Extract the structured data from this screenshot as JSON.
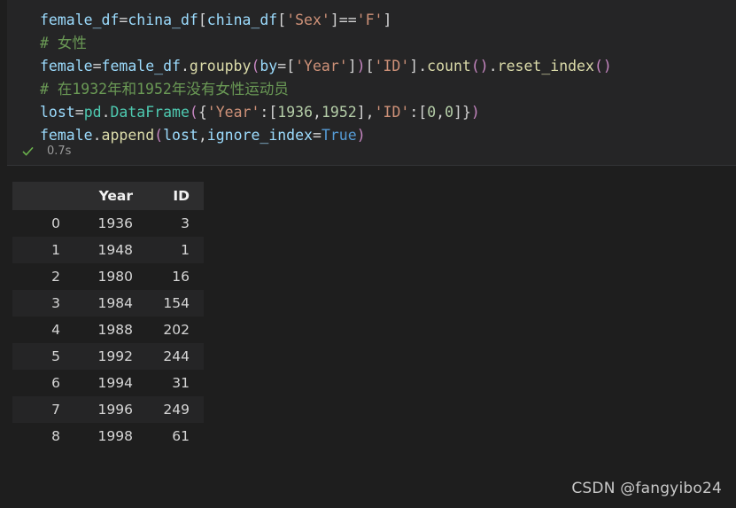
{
  "cell": {
    "code_lines": [
      [
        {
          "t": "female_df",
          "c": "t-var"
        },
        {
          "t": "=",
          "c": "t-pun"
        },
        {
          "t": "china_df",
          "c": "t-var"
        },
        {
          "t": "[",
          "c": "t-brk"
        },
        {
          "t": "china_df",
          "c": "t-var"
        },
        {
          "t": "[",
          "c": "t-brk"
        },
        {
          "t": "'Sex'",
          "c": "t-str"
        },
        {
          "t": "]",
          "c": "t-brk"
        },
        {
          "t": "==",
          "c": "t-pun"
        },
        {
          "t": "'F'",
          "c": "t-str"
        },
        {
          "t": "]",
          "c": "t-brk"
        }
      ],
      [
        {
          "t": "# 女性",
          "c": "t-com"
        }
      ],
      [
        {
          "t": "female",
          "c": "t-var"
        },
        {
          "t": "=",
          "c": "t-pun"
        },
        {
          "t": "female_df",
          "c": "t-var"
        },
        {
          "t": ".",
          "c": "t-pun"
        },
        {
          "t": "groupby",
          "c": "t-fn"
        },
        {
          "t": "(",
          "c": "t-par"
        },
        {
          "t": "by",
          "c": "t-var"
        },
        {
          "t": "=",
          "c": "t-pun"
        },
        {
          "t": "[",
          "c": "t-brk"
        },
        {
          "t": "'Year'",
          "c": "t-str"
        },
        {
          "t": "]",
          "c": "t-brk"
        },
        {
          "t": ")",
          "c": "t-par"
        },
        {
          "t": "[",
          "c": "t-brk"
        },
        {
          "t": "'ID'",
          "c": "t-str"
        },
        {
          "t": "]",
          "c": "t-brk"
        },
        {
          "t": ".",
          "c": "t-pun"
        },
        {
          "t": "count",
          "c": "t-fn"
        },
        {
          "t": "()",
          "c": "t-par"
        },
        {
          "t": ".",
          "c": "t-pun"
        },
        {
          "t": "reset_index",
          "c": "t-fn"
        },
        {
          "t": "()",
          "c": "t-par"
        }
      ],
      [
        {
          "t": "# 在1932年和1952年没有女性运动员",
          "c": "t-com"
        }
      ],
      [
        {
          "t": "lost",
          "c": "t-var"
        },
        {
          "t": "=",
          "c": "t-pun"
        },
        {
          "t": "pd",
          "c": "t-cls"
        },
        {
          "t": ".",
          "c": "t-pun"
        },
        {
          "t": "DataFrame",
          "c": "t-cls"
        },
        {
          "t": "(",
          "c": "t-par"
        },
        {
          "t": "{",
          "c": "t-brk"
        },
        {
          "t": "'Year'",
          "c": "t-str"
        },
        {
          "t": ":",
          "c": "t-pun"
        },
        {
          "t": "[",
          "c": "t-brk"
        },
        {
          "t": "1936",
          "c": "t-num"
        },
        {
          "t": ",",
          "c": "t-pun"
        },
        {
          "t": "1952",
          "c": "t-num"
        },
        {
          "t": "]",
          "c": "t-brk"
        },
        {
          "t": ",",
          "c": "t-pun"
        },
        {
          "t": "'ID'",
          "c": "t-str"
        },
        {
          "t": ":",
          "c": "t-pun"
        },
        {
          "t": "[",
          "c": "t-brk"
        },
        {
          "t": "0",
          "c": "t-num"
        },
        {
          "t": ",",
          "c": "t-pun"
        },
        {
          "t": "0",
          "c": "t-num"
        },
        {
          "t": "]",
          "c": "t-brk"
        },
        {
          "t": "}",
          "c": "t-brk"
        },
        {
          "t": ")",
          "c": "t-par"
        }
      ],
      [
        {
          "t": "female",
          "c": "t-var"
        },
        {
          "t": ".",
          "c": "t-pun"
        },
        {
          "t": "append",
          "c": "t-fn"
        },
        {
          "t": "(",
          "c": "t-par"
        },
        {
          "t": "lost",
          "c": "t-var"
        },
        {
          "t": ",",
          "c": "t-pun"
        },
        {
          "t": "ignore_index",
          "c": "t-var"
        },
        {
          "t": "=",
          "c": "t-pun"
        },
        {
          "t": "True",
          "c": "t-kw"
        },
        {
          "t": ")",
          "c": "t-par"
        }
      ]
    ],
    "status": {
      "icon": "check-icon",
      "icon_color": "#6ab04c",
      "time": "0.7s"
    }
  },
  "output": {
    "table": {
      "columns": [
        "",
        "Year",
        "ID"
      ],
      "rows": [
        {
          "index": "0",
          "Year": "1936",
          "ID": "3"
        },
        {
          "index": "1",
          "Year": "1948",
          "ID": "1"
        },
        {
          "index": "2",
          "Year": "1980",
          "ID": "16"
        },
        {
          "index": "3",
          "Year": "1984",
          "ID": "154"
        },
        {
          "index": "4",
          "Year": "1988",
          "ID": "202"
        },
        {
          "index": "5",
          "Year": "1992",
          "ID": "244"
        },
        {
          "index": "6",
          "Year": "1994",
          "ID": "31"
        },
        {
          "index": "7",
          "Year": "1996",
          "ID": "249"
        },
        {
          "index": "8",
          "Year": "1998",
          "ID": "61"
        }
      ]
    }
  },
  "watermark": {
    "text": "CSDN @fangyibo24"
  },
  "colors": {
    "background": "#1e1e1e",
    "cell_background": "#252526",
    "header_background": "#2d2d2e",
    "stripe": "#252526",
    "success": "#6ab04c"
  }
}
